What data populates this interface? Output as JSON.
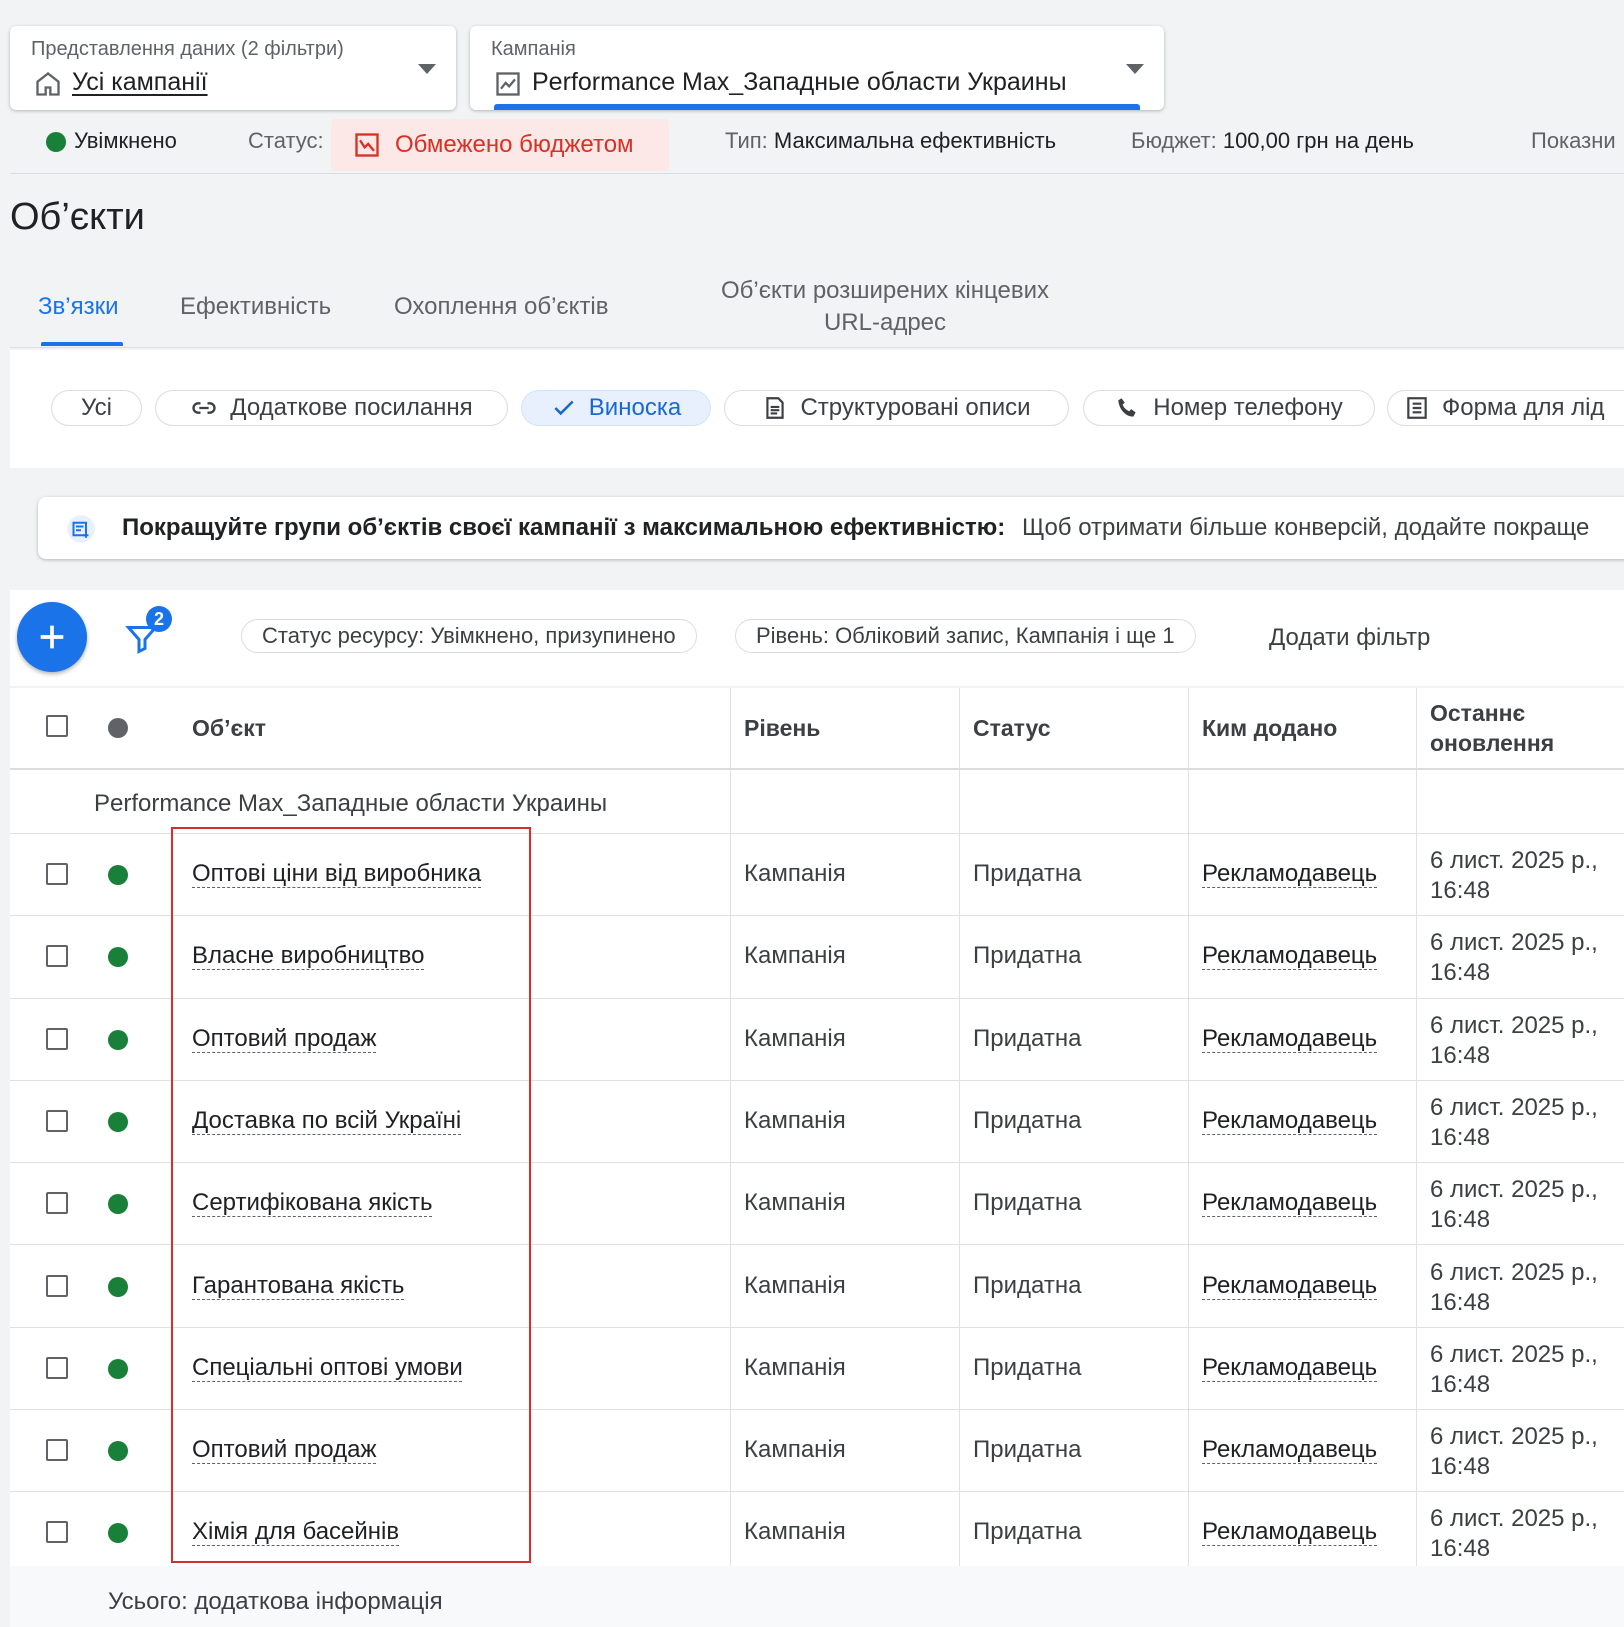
{
  "data_view": {
    "label": "Представлення даних (2 фільтри)",
    "value": "Усі кампанії"
  },
  "campaign": {
    "label": "Кампанія",
    "value": "Performance Max_Западные области Украины"
  },
  "status_bar": {
    "enabled": "Увімкнено",
    "status_label": "Статус:",
    "status_value": "Обмежено бюджетом",
    "type_label": "Тип:",
    "type_value": "Максимальна ефективність",
    "budget_label": "Бюджет:",
    "budget_value": "100,00 грн на день",
    "metrics": "Показни"
  },
  "page_title": "Об’єкти",
  "tabs": [
    {
      "label": "Зв’язки"
    },
    {
      "label": "Ефективність"
    },
    {
      "label": "Охоплення об’єктів"
    },
    {
      "label": "Об’єкти розширених кінцевих URL-адрес"
    }
  ],
  "chips": [
    {
      "label": "Усі"
    },
    {
      "label": "Додаткове посилання"
    },
    {
      "label": "Виноска"
    },
    {
      "label": "Структуровані описи"
    },
    {
      "label": "Номер телефону"
    },
    {
      "label": "Форма для лід"
    }
  ],
  "banner": {
    "bold": "Покращуйте групи об’єктів своєї кампанії з максимальною ефективністю:",
    "text": "Щоб отримати більше конверсій, додайте покраще"
  },
  "filters": {
    "count": "2",
    "f1": "Статус ресурсу: Увімкнено, призупинено",
    "f2": "Рівень: Обліковий запис, Кампанія і ще 1",
    "add": "Додати фільтр"
  },
  "table": {
    "headers": {
      "object": "Об’єкт",
      "level": "Рівень",
      "status": "Статус",
      "added_by": "Ким додано",
      "updated_1": "Останнє",
      "updated_2": "оновлення"
    },
    "group": "Performance Max_Западные области Украины",
    "rows": [
      {
        "object": "Оптові ціни від виробника",
        "level": "Кампанія",
        "status": "Придатна",
        "added_by": "Рекламодавець",
        "date": "6 лист. 2025 р.,",
        "time": "16:48"
      },
      {
        "object": "Власне виробництво",
        "level": "Кампанія",
        "status": "Придатна",
        "added_by": "Рекламодавець",
        "date": "6 лист. 2025 р.,",
        "time": "16:48"
      },
      {
        "object": "Оптовий продаж",
        "level": "Кампанія",
        "status": "Придатна",
        "added_by": "Рекламодавець",
        "date": "6 лист. 2025 р.,",
        "time": "16:48"
      },
      {
        "object": "Доставка по всій Україні",
        "level": "Кампанія",
        "status": "Придатна",
        "added_by": "Рекламодавець",
        "date": "6 лист. 2025 р.,",
        "time": "16:48"
      },
      {
        "object": "Сертифікована якість",
        "level": "Кампанія",
        "status": "Придатна",
        "added_by": "Рекламодавець",
        "date": "6 лист. 2025 р.,",
        "time": "16:48"
      },
      {
        "object": "Гарантована якість",
        "level": "Кампанія",
        "status": "Придатна",
        "added_by": "Рекламодавець",
        "date": "6 лист. 2025 р.,",
        "time": "16:48"
      },
      {
        "object": "Спеціальні оптові умови",
        "level": "Кампанія",
        "status": "Придатна",
        "added_by": "Рекламодавець",
        "date": "6 лист. 2025 р.,",
        "time": "16:48"
      },
      {
        "object": "Оптовий продаж",
        "level": "Кампанія",
        "status": "Придатна",
        "added_by": "Рекламодавець",
        "date": "6 лист. 2025 р.,",
        "time": "16:48"
      },
      {
        "object": "Хімія для басейнів",
        "level": "Кампанія",
        "status": "Придатна",
        "added_by": "Рекламодавець",
        "date": "6 лист. 2025 р.,",
        "time": "16:48"
      }
    ],
    "total": "Усього: додаткова інформація"
  },
  "colors": {
    "accent": "#1a73e8",
    "enabled": "#188038",
    "warning": "#d93025",
    "highlight": "#d32f2f"
  }
}
